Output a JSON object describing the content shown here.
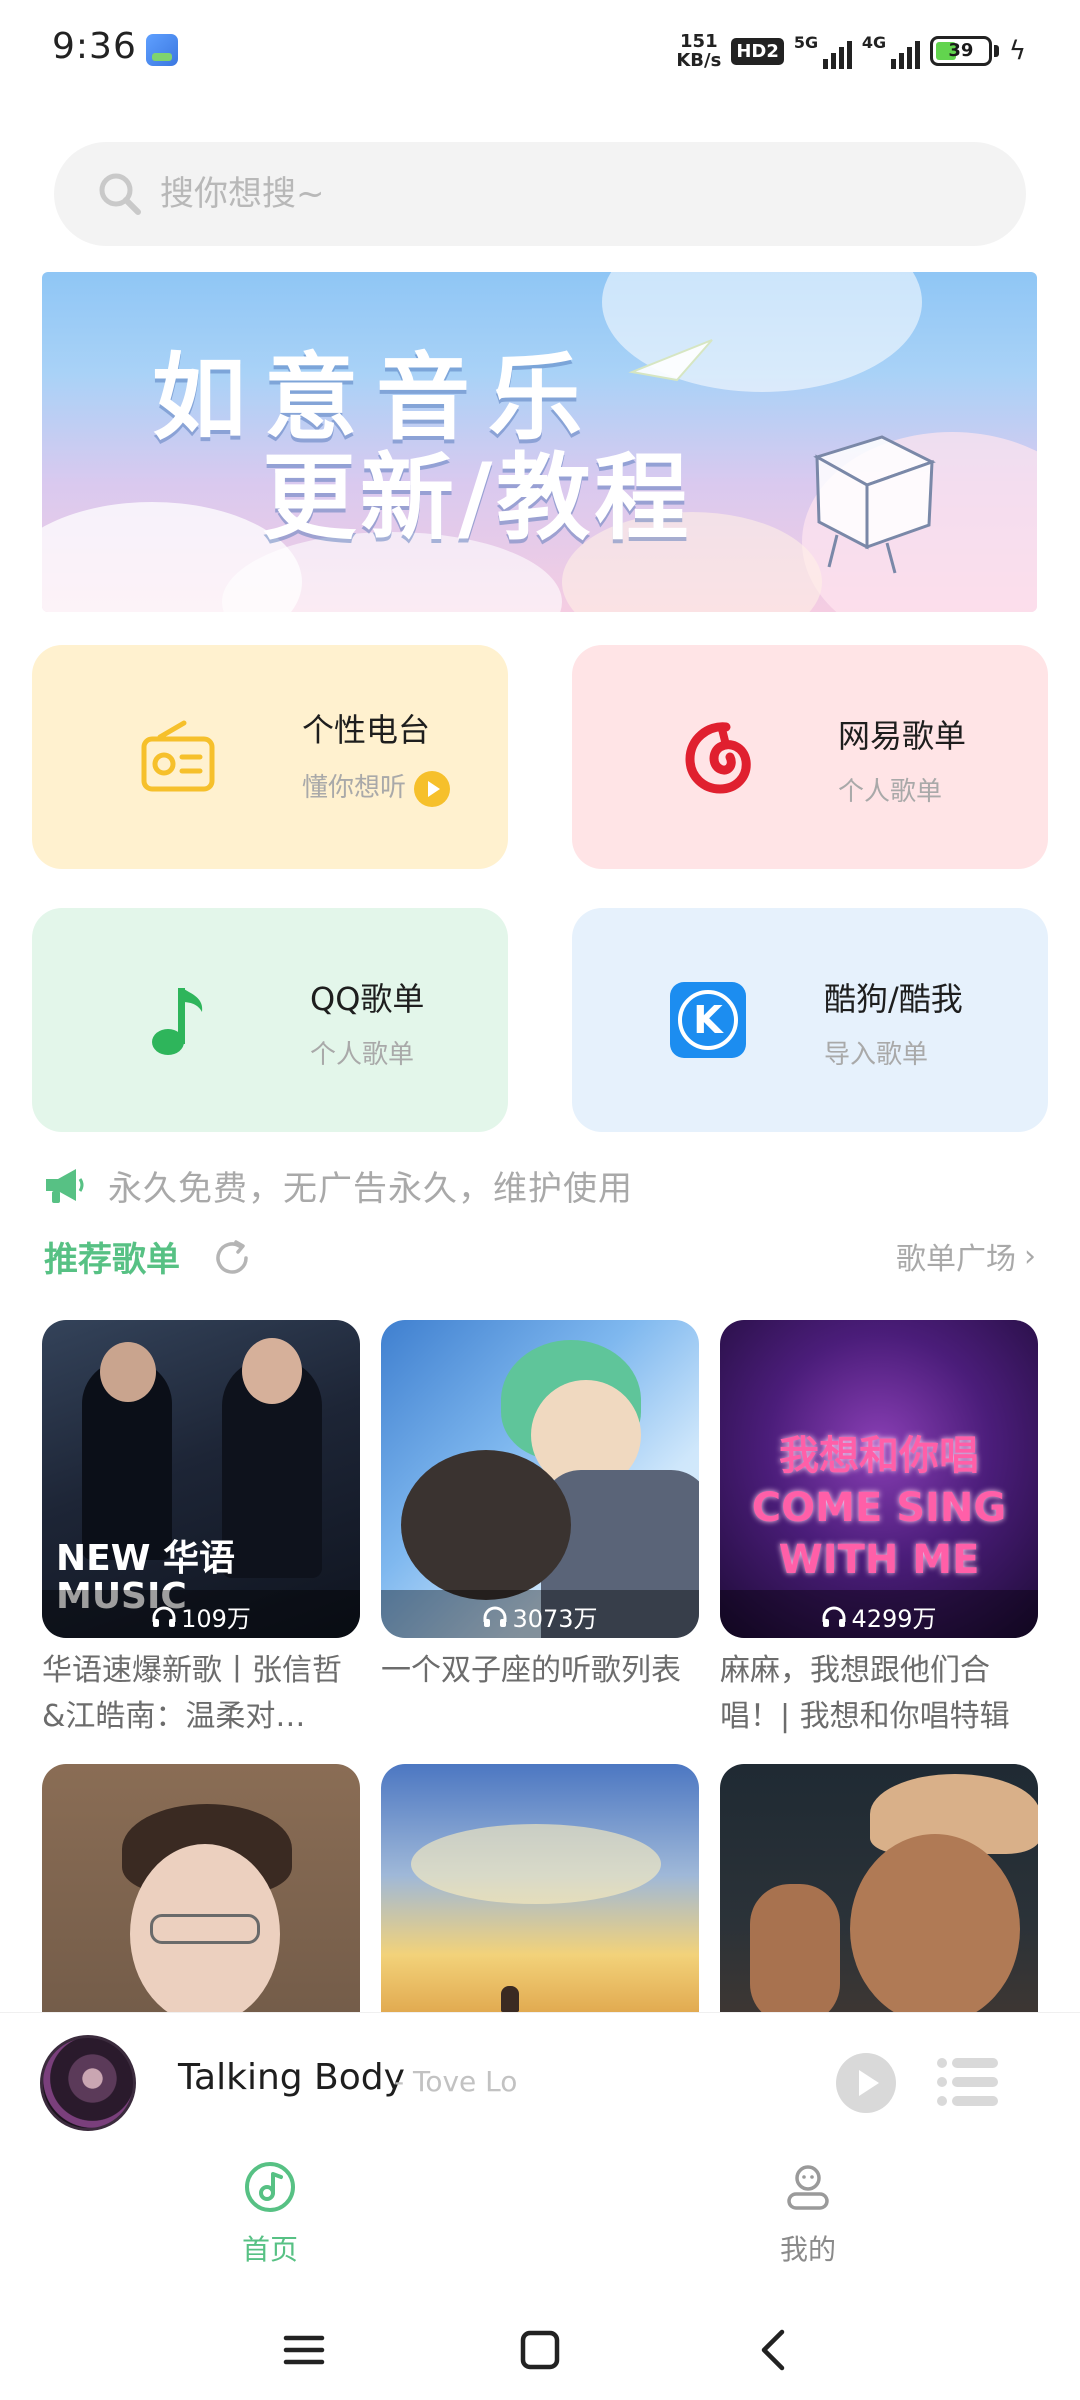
{
  "status": {
    "time": "9:36",
    "speed_value": "151",
    "speed_unit": "KB/s",
    "hd": "HD2",
    "gen1": "5G",
    "gen2": "4G",
    "battery": "39"
  },
  "search": {
    "placeholder": "搜你想搜~"
  },
  "banner": {
    "line1": "如意音乐",
    "line2": "更新/教程"
  },
  "cards": [
    {
      "title": "个性电台",
      "subtitle": "懂你想听",
      "icon": "radio-icon",
      "color": "#f6c02b"
    },
    {
      "title": "网易歌单",
      "subtitle": "个人歌单",
      "icon": "netease-icon",
      "color": "#e0202f"
    },
    {
      "title": "QQ歌单",
      "subtitle": "个人歌单",
      "icon": "qq-music-icon",
      "color": "#2eb55b"
    },
    {
      "title": "酷狗/酷我",
      "subtitle": "导入歌单",
      "icon": "kugou-icon",
      "color": "#1c8df0"
    }
  ],
  "notice": {
    "text": "永久免费，无广告永久，维护使用"
  },
  "recommend": {
    "title": "推荐歌单",
    "square_label": "歌单广场"
  },
  "playlists": [
    {
      "plays": "109万",
      "title": "华语速爆新歌丨张信哲&江皓南：温柔对…",
      "cover_badge": "NEW 华语 MUSIC"
    },
    {
      "plays": "3073万",
      "title": "一个双子座的听歌列表"
    },
    {
      "plays": "4299万",
      "title": "麻麻，我想跟他们合唱！| 我想和你唱特辑",
      "cover_badge": "我想和你唱 COME SING WITH ME"
    },
    {
      "plays": "",
      "title": ""
    },
    {
      "plays": "",
      "title": ""
    },
    {
      "plays": "",
      "title": ""
    }
  ],
  "player": {
    "track": "Talking Body",
    "artist": "- Tove Lo"
  },
  "tabs": [
    {
      "label": "首页",
      "icon": "music-disc-icon",
      "active": true
    },
    {
      "label": "我的",
      "icon": "user-icon",
      "active": false
    }
  ],
  "theme": {
    "accent": "#57c184"
  }
}
